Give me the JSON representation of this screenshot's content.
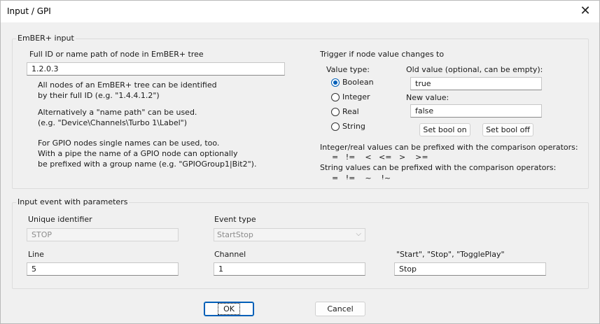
{
  "window": {
    "title": "Input / GPI",
    "close_glyph": "✕"
  },
  "ember": {
    "group_title": "EmBER+ input",
    "path_label": "Full ID or name path of node in EmBER+ tree",
    "path_value": "1.2.0.3",
    "help1": "All nodes of an EmBER+ tree can be identified\nby their full ID (e.g. \"1.4.4.1.2\")",
    "help2": "Alternatively a \"name path\" can be used.\n(e.g. \"Device\\Channels\\Turbo 1\\Label\")",
    "help3": "For GPIO nodes single names can be used, too.\nWith a pipe the name of a GPIO node can optionally\nbe prefixed with a group name (e.g. \"GPIOGroup1|Bit2\")."
  },
  "trigger": {
    "label": "Trigger if node value changes to",
    "value_type_label": "Value type:",
    "types": [
      {
        "label": "Boolean",
        "checked": true
      },
      {
        "label": "Integer",
        "checked": false
      },
      {
        "label": "Real",
        "checked": false
      },
      {
        "label": "String",
        "checked": false
      }
    ],
    "old_label": "Old value (optional, can be empty):",
    "old_value": "true",
    "new_label": "New value:",
    "new_value": "false",
    "bool_on": "Set bool on",
    "bool_off": "Set bool off",
    "int_note": "Integer/real values can be prefixed with the comparison operators:",
    "int_ops": "=   !=    <   <=   >    >=",
    "str_note": "String values can be prefixed with the comparison operators:",
    "str_ops": "=   !=    ~    !~"
  },
  "event": {
    "group_title": "Input event with parameters",
    "uid_label": "Unique identifier",
    "uid_value": "STOP",
    "event_type_label": "Event type",
    "event_type_value": "StartStop",
    "line_label": "Line",
    "line_value": "5",
    "channel_label": "Channel",
    "channel_value": "1",
    "param_label": "\"Start\", \"Stop\", \"TogglePlay\"",
    "param_value": "Stop"
  },
  "buttons": {
    "ok": "OK",
    "cancel": "Cancel"
  }
}
